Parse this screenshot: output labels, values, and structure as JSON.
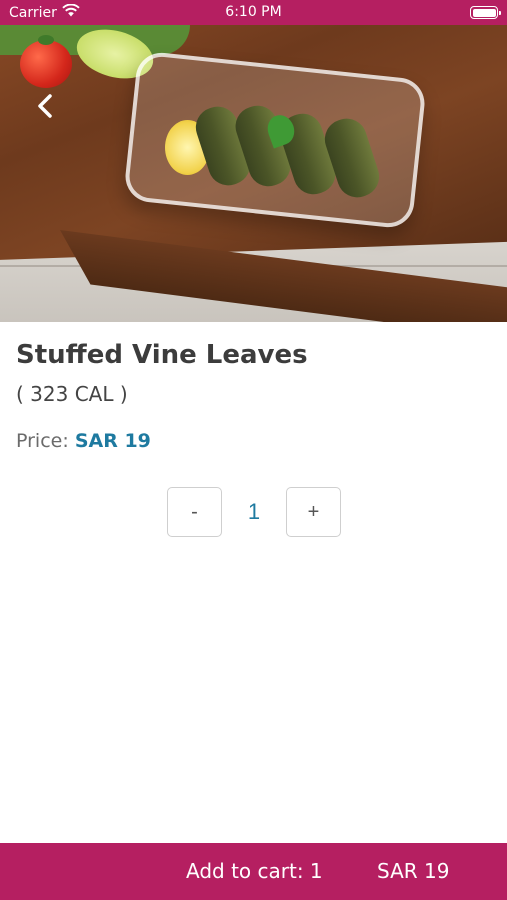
{
  "status_bar": {
    "carrier": "Carrier",
    "time": "6:10 PM"
  },
  "product": {
    "name": "Stuffed Vine Leaves",
    "calories": "( 323 CAL )",
    "price_label": "Price:",
    "price_value": "SAR 19"
  },
  "stepper": {
    "minus_label": "-",
    "quantity": "1",
    "plus_label": "+"
  },
  "cart_bar": {
    "label": "Add to cart: 1",
    "total": "SAR 19"
  },
  "colors": {
    "brand": "#b51f61",
    "accent": "#1e7aa0"
  },
  "icons": {
    "back": "chevron-left-icon",
    "wifi": "wifi-icon",
    "battery": "battery-icon"
  }
}
